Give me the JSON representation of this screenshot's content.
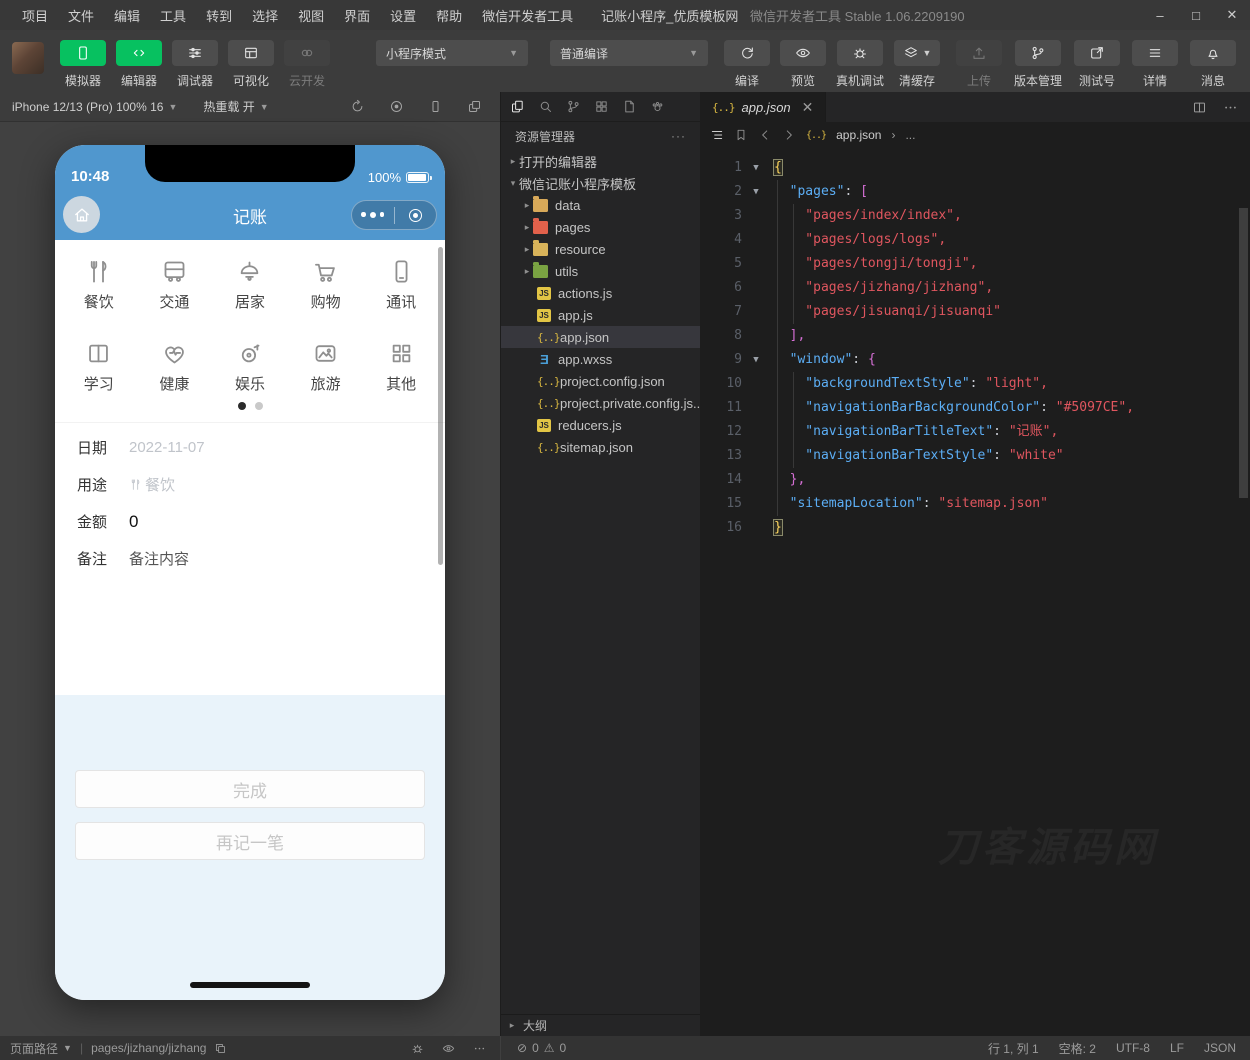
{
  "colors": {
    "nav_blue": "#5097CE",
    "wechat_green": "#07c160"
  },
  "titlebar": {
    "menus": [
      "项目",
      "文件",
      "编辑",
      "工具",
      "转到",
      "选择",
      "视图",
      "界面",
      "设置",
      "帮助",
      "微信开发者工具"
    ],
    "title": "记账小程序_优质模板网",
    "version": "微信开发者工具 Stable 1.06.2209190",
    "controls": {
      "minimize": "–",
      "maximize": "□",
      "close": "✕"
    }
  },
  "toolbar": {
    "view_buttons": [
      {
        "label": "模拟器",
        "icon": "phone",
        "state": "green"
      },
      {
        "label": "编辑器",
        "icon": "code",
        "state": "green"
      },
      {
        "label": "调试器",
        "icon": "sliders",
        "state": "normal"
      },
      {
        "label": "可视化",
        "icon": "layout",
        "state": "normal"
      },
      {
        "label": "云开发",
        "icon": "cloud",
        "state": "disabled"
      }
    ],
    "mode_select": "小程序模式",
    "compile_select": "普通编译",
    "compile_actions": [
      {
        "label": "编译",
        "icon": "refresh",
        "caret": false
      },
      {
        "label": "预览",
        "icon": "eye",
        "caret": false
      },
      {
        "label": "真机调试",
        "icon": "bug",
        "caret": false
      },
      {
        "label": "清缓存",
        "icon": "layers",
        "caret": true
      }
    ],
    "right_actions": [
      {
        "label": "上传",
        "icon": "upload",
        "state": "disabled"
      },
      {
        "label": "版本管理",
        "icon": "branch",
        "state": "normal"
      },
      {
        "label": "测试号",
        "icon": "external",
        "state": "normal"
      },
      {
        "label": "详情",
        "icon": "list",
        "state": "normal"
      },
      {
        "label": "消息",
        "icon": "bell",
        "state": "normal"
      }
    ]
  },
  "simulator": {
    "device": "iPhone 12/13 (Pro) 100% 16",
    "hot_reload_label": "热重载 开"
  },
  "phone": {
    "time": "10:48",
    "battery": "100%",
    "nav_title": "记账",
    "categories": [
      {
        "label": "餐饮",
        "icon": "food"
      },
      {
        "label": "交通",
        "icon": "bus"
      },
      {
        "label": "居家",
        "icon": "lamp"
      },
      {
        "label": "购物",
        "icon": "cart"
      },
      {
        "label": "通讯",
        "icon": "mobile"
      },
      {
        "label": "学习",
        "icon": "book"
      },
      {
        "label": "健康",
        "icon": "heart"
      },
      {
        "label": "娱乐",
        "icon": "fun"
      },
      {
        "label": "旅游",
        "icon": "travel"
      },
      {
        "label": "其他",
        "icon": "grid2"
      }
    ],
    "form": [
      {
        "label": "日期",
        "value": "2022-11-07",
        "style": "muted",
        "icon": ""
      },
      {
        "label": "用途",
        "value": "餐饮",
        "style": "muted",
        "icon": "food"
      },
      {
        "label": "金额",
        "value": "0",
        "style": "amount",
        "icon": ""
      },
      {
        "label": "备注",
        "value": "备注内容",
        "style": "plain",
        "icon": ""
      }
    ],
    "buttons": [
      "完成",
      "再记一笔"
    ]
  },
  "explorer": {
    "title": "资源管理器",
    "more": "···",
    "open_editors": "打开的编辑器",
    "project": "微信记账小程序模板",
    "tree": [
      {
        "name": "data",
        "kind": "folder",
        "color": "#d8a959"
      },
      {
        "name": "pages",
        "kind": "folder",
        "color": "#e2614b"
      },
      {
        "name": "resource",
        "kind": "folder",
        "color": "#d8b35a"
      },
      {
        "name": "utils",
        "kind": "folder",
        "color": "#7aa342"
      },
      {
        "name": "actions.js",
        "kind": "js"
      },
      {
        "name": "app.js",
        "kind": "js"
      },
      {
        "name": "app.json",
        "kind": "json",
        "selected": true
      },
      {
        "name": "app.wxss",
        "kind": "wxss"
      },
      {
        "name": "project.config.json",
        "kind": "json"
      },
      {
        "name": "project.private.config.js...",
        "kind": "json"
      },
      {
        "name": "reducers.js",
        "kind": "js"
      },
      {
        "name": "sitemap.json",
        "kind": "json"
      }
    ],
    "outline_label": "大纲",
    "errors": "0",
    "warnings": "0"
  },
  "editor": {
    "tab": "app.json",
    "tab_close": "✕",
    "breadcrumb_file": "app.json",
    "breadcrumb_more": "...",
    "watermark": "刀客源码网",
    "code": [
      {
        "n": "1",
        "fold": true,
        "tokens": [
          [
            "{",
            "b1 match"
          ]
        ]
      },
      {
        "n": "2",
        "fold": true,
        "tokens": [
          [
            "  \"pages\"",
            "key"
          ],
          [
            ": ",
            "pl"
          ],
          [
            "[",
            "b2"
          ]
        ]
      },
      {
        "n": "3",
        "fold": false,
        "tokens": [
          [
            "    \"pages/index/index\",",
            "str"
          ]
        ]
      },
      {
        "n": "4",
        "fold": false,
        "tokens": [
          [
            "    \"pages/logs/logs\",",
            "str"
          ]
        ]
      },
      {
        "n": "5",
        "fold": false,
        "tokens": [
          [
            "    \"pages/tongji/tongji\",",
            "str"
          ]
        ]
      },
      {
        "n": "6",
        "fold": false,
        "tokens": [
          [
            "    \"pages/jizhang/jizhang\",",
            "str"
          ]
        ]
      },
      {
        "n": "7",
        "fold": false,
        "tokens": [
          [
            "    \"pages/jisuanqi/jisuanqi\"",
            "str"
          ]
        ]
      },
      {
        "n": "8",
        "fold": false,
        "tokens": [
          [
            "  ],",
            "b2"
          ]
        ]
      },
      {
        "n": "9",
        "fold": true,
        "tokens": [
          [
            "  \"window\"",
            "key"
          ],
          [
            ": ",
            "pl"
          ],
          [
            "{",
            "b2"
          ]
        ]
      },
      {
        "n": "10",
        "fold": false,
        "tokens": [
          [
            "    \"backgroundTextStyle\"",
            "key"
          ],
          [
            ": ",
            "pl"
          ],
          [
            "\"light\",",
            "str"
          ]
        ]
      },
      {
        "n": "11",
        "fold": false,
        "tokens": [
          [
            "    \"navigationBarBackgroundColor\"",
            "key"
          ],
          [
            ": ",
            "pl"
          ],
          [
            "\"#5097CE\",",
            "str"
          ]
        ]
      },
      {
        "n": "12",
        "fold": false,
        "tokens": [
          [
            "    \"navigationBarTitleText\"",
            "key"
          ],
          [
            ": ",
            "pl"
          ],
          [
            "\"记账\",",
            "str"
          ]
        ]
      },
      {
        "n": "13",
        "fold": false,
        "tokens": [
          [
            "    \"navigationBarTextStyle\"",
            "key"
          ],
          [
            ": ",
            "pl"
          ],
          [
            "\"white\"",
            "str"
          ]
        ]
      },
      {
        "n": "14",
        "fold": false,
        "tokens": [
          [
            "  },",
            "b2"
          ]
        ]
      },
      {
        "n": "15",
        "fold": false,
        "tokens": [
          [
            "  \"sitemapLocation\"",
            "key"
          ],
          [
            ": ",
            "pl"
          ],
          [
            "\"sitemap.json\"",
            "str"
          ]
        ]
      },
      {
        "n": "16",
        "fold": false,
        "tokens": [
          [
            "}",
            "b1 match"
          ]
        ]
      }
    ]
  },
  "statusbar": {
    "page_path_label": "页面路径",
    "page_path": "pages/jizhang/jizhang",
    "line_col": "行 1, 列 1",
    "spaces": "空格: 2",
    "encoding": "UTF-8",
    "eol": "LF",
    "language": "JSON"
  }
}
